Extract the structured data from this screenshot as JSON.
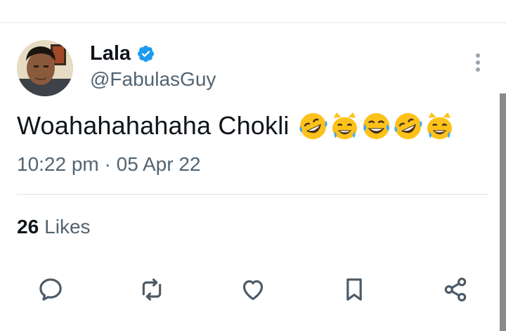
{
  "tweet": {
    "author": {
      "display_name": "Lala",
      "handle": "@FabulasGuy",
      "verified": true,
      "avatar": "profile-photo"
    },
    "text": "Woahahahahaha Chokli",
    "emojis": [
      "rolling-on-floor-laughing",
      "grinning-cat-with-smiling-eyes",
      "face-with-tears-of-joy",
      "rolling-on-floor-laughing",
      "grinning-cat-with-smiling-eyes"
    ],
    "timestamp": "10:22 pm · 05 Apr 22",
    "likes": {
      "count": "26",
      "label": "Likes"
    }
  },
  "actions": {
    "icons": [
      "reply-icon",
      "retweet-icon",
      "like-icon",
      "bookmark-icon",
      "share-icon"
    ]
  },
  "colors": {
    "text": "#0f1419",
    "secondary": "#536471",
    "verified": "#1d9bf0",
    "icon": "#4d5a66",
    "divider": "#e2e2e2"
  }
}
